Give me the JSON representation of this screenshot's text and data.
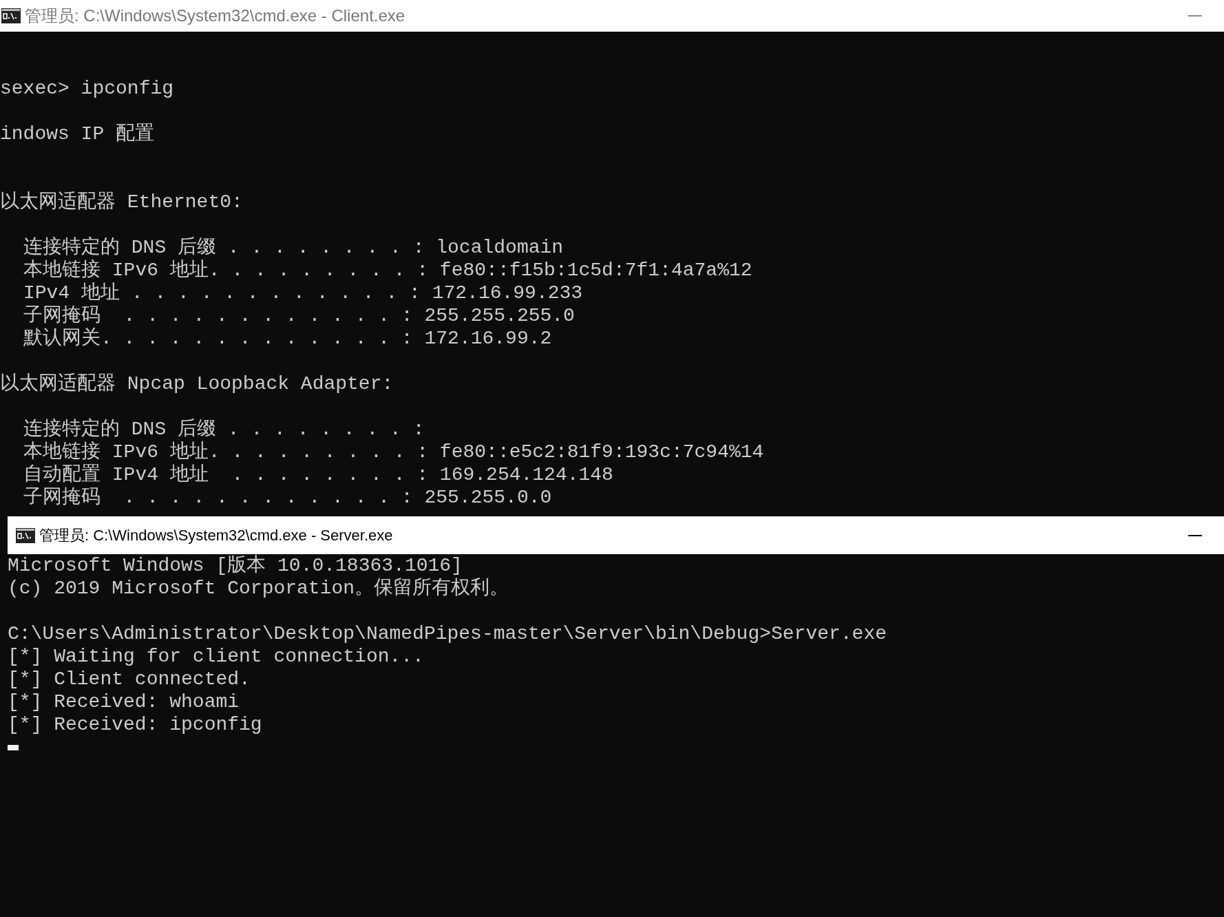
{
  "windows": [
    {
      "title": "管理员: C:\\Windows\\System32\\cmd.exe - Client.exe",
      "lines": [
        {
          "kind": "spacer"
        },
        {
          "kind": "spacer"
        },
        {
          "kind": "line",
          "text": "sexec> ipconfig"
        },
        {
          "kind": "spacer"
        },
        {
          "kind": "line",
          "text": "indows IP 配置"
        },
        {
          "kind": "spacer"
        },
        {
          "kind": "spacer"
        },
        {
          "kind": "line",
          "text": "以太网适配器 Ethernet0:"
        },
        {
          "kind": "spacer"
        },
        {
          "kind": "entry",
          "text": "连接特定的 DNS 后缀 . . . . . . . . : localdomain"
        },
        {
          "kind": "entry",
          "text": "本地链接 IPv6 地址. . . . . . . . . : fe80::f15b:1c5d:7f1:4a7a%12"
        },
        {
          "kind": "entry",
          "text": "IPv4 地址 . . . . . . . . . . . . : 172.16.99.233"
        },
        {
          "kind": "entry",
          "text": "子网掩码  . . . . . . . . . . . . : 255.255.255.0"
        },
        {
          "kind": "entry",
          "text": "默认网关. . . . . . . . . . . . . : 172.16.99.2"
        },
        {
          "kind": "spacer"
        },
        {
          "kind": "line",
          "text": "以太网适配器 Npcap Loopback Adapter:"
        },
        {
          "kind": "spacer"
        },
        {
          "kind": "entry",
          "text": "连接特定的 DNS 后缀 . . . . . . . . :"
        },
        {
          "kind": "entry",
          "text": "本地链接 IPv6 地址. . . . . . . . . : fe80::e5c2:81f9:193c:7c94%14"
        },
        {
          "kind": "entry",
          "text": "自动配置 IPv4 地址  . . . . . . . . : 169.254.124.148"
        },
        {
          "kind": "entry",
          "text": "子网掩码  . . . . . . . . . . . . : 255.255.0.0"
        }
      ]
    },
    {
      "title": "管理员: C:\\Windows\\System32\\cmd.exe - Server.exe",
      "lines": [
        {
          "kind": "line",
          "text": "Microsoft Windows [版本 10.0.18363.1016]"
        },
        {
          "kind": "line",
          "text": "(c) 2019 Microsoft Corporation。保留所有权利。"
        },
        {
          "kind": "spacer"
        },
        {
          "kind": "line",
          "text": "C:\\Users\\Administrator\\Desktop\\NamedPipes-master\\Server\\bin\\Debug>Server.exe"
        },
        {
          "kind": "line",
          "text": "[*] Waiting for client connection..."
        },
        {
          "kind": "line",
          "text": "[*] Client connected."
        },
        {
          "kind": "line",
          "text": "[*] Received: whoami"
        },
        {
          "kind": "line",
          "text": "[*] Received: ipconfig"
        },
        {
          "kind": "cursor"
        }
      ]
    }
  ]
}
